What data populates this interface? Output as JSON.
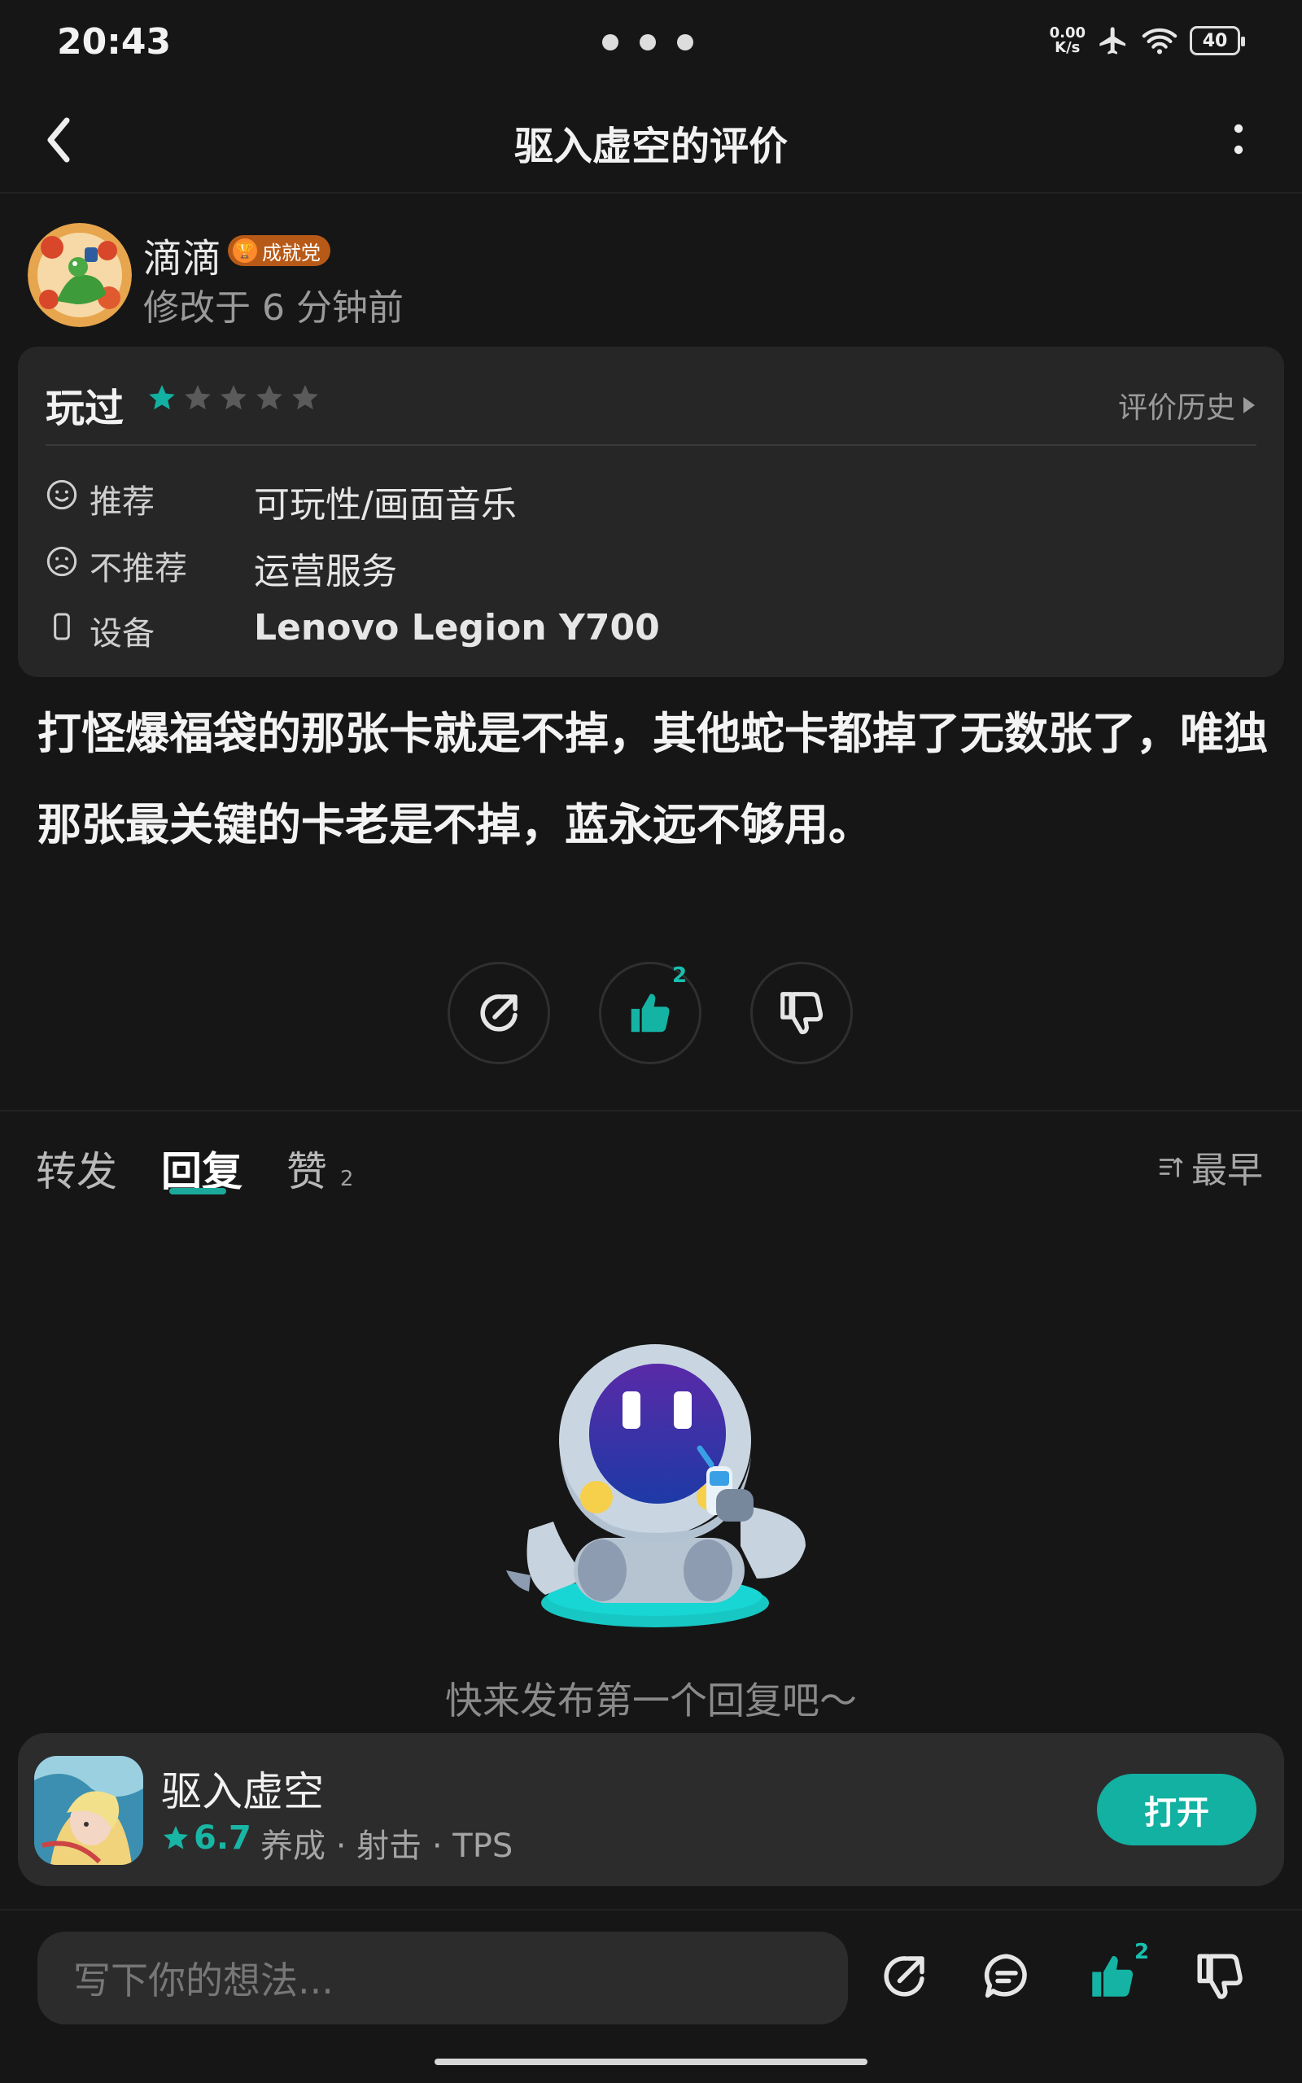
{
  "status": {
    "time": "20:43",
    "net_value": "0.00",
    "net_unit": "K/s",
    "battery": "40"
  },
  "header": {
    "title": "驱入虚空的评价"
  },
  "user": {
    "name": "滴滴",
    "badge": "成就党",
    "modified": "修改于 6 分钟前"
  },
  "review": {
    "played_label": "玩过",
    "rating": 1,
    "rating_max": 5,
    "history_label": "评价历史",
    "rows": [
      {
        "icon": "smile-icon",
        "label": "推荐",
        "value": "可玩性/画面音乐"
      },
      {
        "icon": "frown-icon",
        "label": "不推荐",
        "value": "运营服务"
      },
      {
        "icon": "phone-icon",
        "label": "设备",
        "value": "Lenovo Legion Y700"
      }
    ],
    "text": "打怪爆福袋的那张卡就是不掉，其他蛇卡都掉了无数张了，唯独那张最关键的卡老是不掉，蓝永远不够用。",
    "like_count": "2"
  },
  "tabs": [
    {
      "label": "转发"
    },
    {
      "label": "回复",
      "active": true
    },
    {
      "label": "赞",
      "count": "2"
    }
  ],
  "sort_label": "最早",
  "empty_text": "快来发布第一个回复吧～",
  "game": {
    "name": "驱入虚空",
    "score": "6.7",
    "tags": "养成 · 射击 · TPS",
    "open_label": "打开"
  },
  "bottom": {
    "input_placeholder": "写下你的想法...",
    "like_count": "2"
  },
  "colors": {
    "accent": "#12b1a2",
    "background": "#161616",
    "card": "#262626",
    "badge": "#b85a17"
  }
}
